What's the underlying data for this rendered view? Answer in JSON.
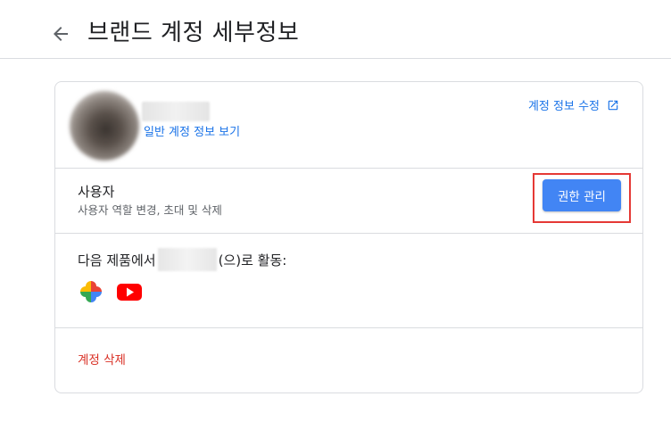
{
  "header": {
    "back_icon": "arrow-back-icon",
    "title": "브랜드 계정 세부정보"
  },
  "account": {
    "general_info_link": "일반 계정 정보 보기",
    "edit_link": "계정 정보 수정",
    "edit_icon": "open-in-new-icon"
  },
  "users": {
    "title": "사용자",
    "subtitle": "사용자 역할 변경, 초대 및 삭제",
    "manage_button": "권한 관리"
  },
  "activity": {
    "prefix": "다음 제품에서",
    "suffix": "(으)로 활동:",
    "products": [
      {
        "name": "google-photos-icon"
      },
      {
        "name": "youtube-icon"
      }
    ]
  },
  "delete": {
    "label": "계정 삭제"
  },
  "colors": {
    "link": "#1a73e8",
    "button": "#4285f4",
    "highlight": "#e53935",
    "danger": "#d93025"
  }
}
